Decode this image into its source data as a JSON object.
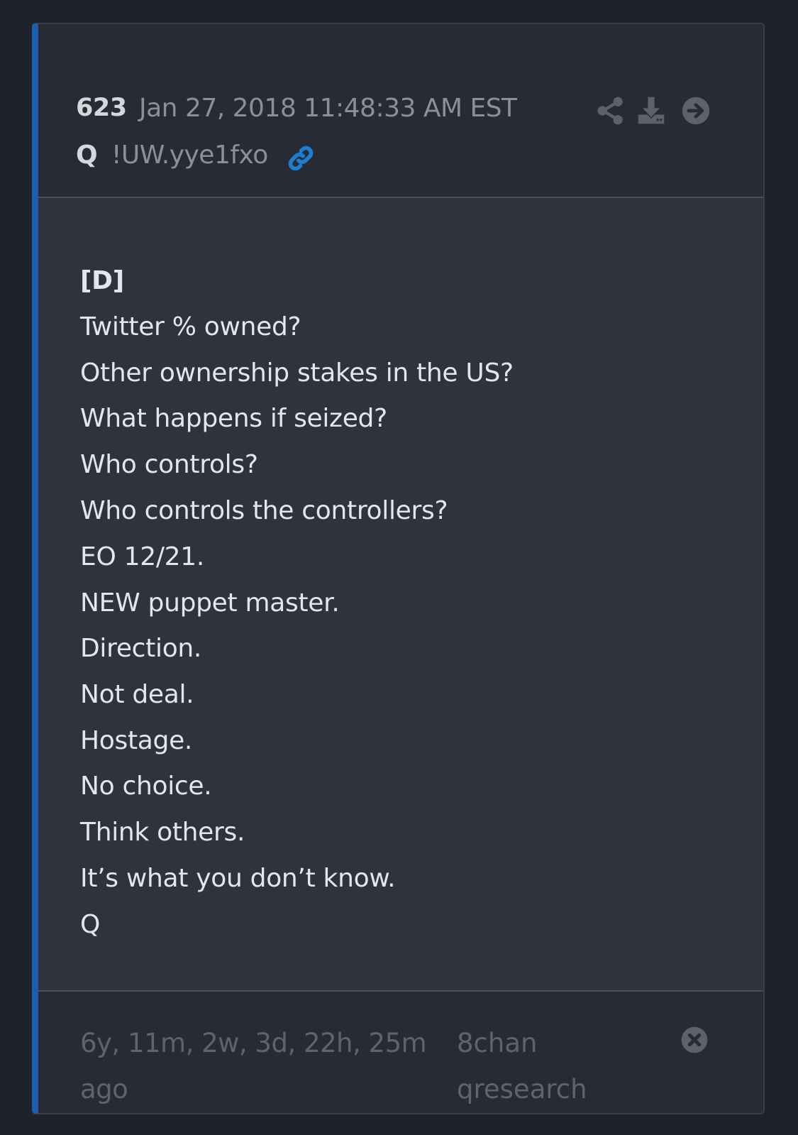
{
  "post": {
    "number": "623",
    "date": "Jan 27, 2018 11:48:33 AM EST",
    "author": "Q",
    "tripcode": "!UW.yye1fxo"
  },
  "icons": {
    "link": "link-icon",
    "share": "share-icon",
    "download": "download-icon",
    "goto": "arrow-circle-right-icon",
    "close": "close-circle-icon"
  },
  "body": {
    "lines": [
      "[D]",
      "Twitter % owned?",
      "Other ownership stakes in the US?",
      "What happens if seized?",
      "Who controls?",
      "Who controls the controllers?",
      "EO 12/21.",
      "NEW puppet master.",
      "Direction.",
      "Not deal.",
      "Hostage.",
      "No choice.",
      "Think others.",
      "It’s what you don’t know.",
      "Q"
    ]
  },
  "footer": {
    "ago": "6y, 11m, 2w, 3d, 22h, 25m ago",
    "source_board": "8chan",
    "source_name": "qresearch"
  },
  "colors": {
    "accent_bar": "#1c5fb1",
    "link_icon": "#1b7fd1",
    "page_bg": "#1e222a",
    "card_bg": "#262b34",
    "body_bg": "#2e333d"
  }
}
